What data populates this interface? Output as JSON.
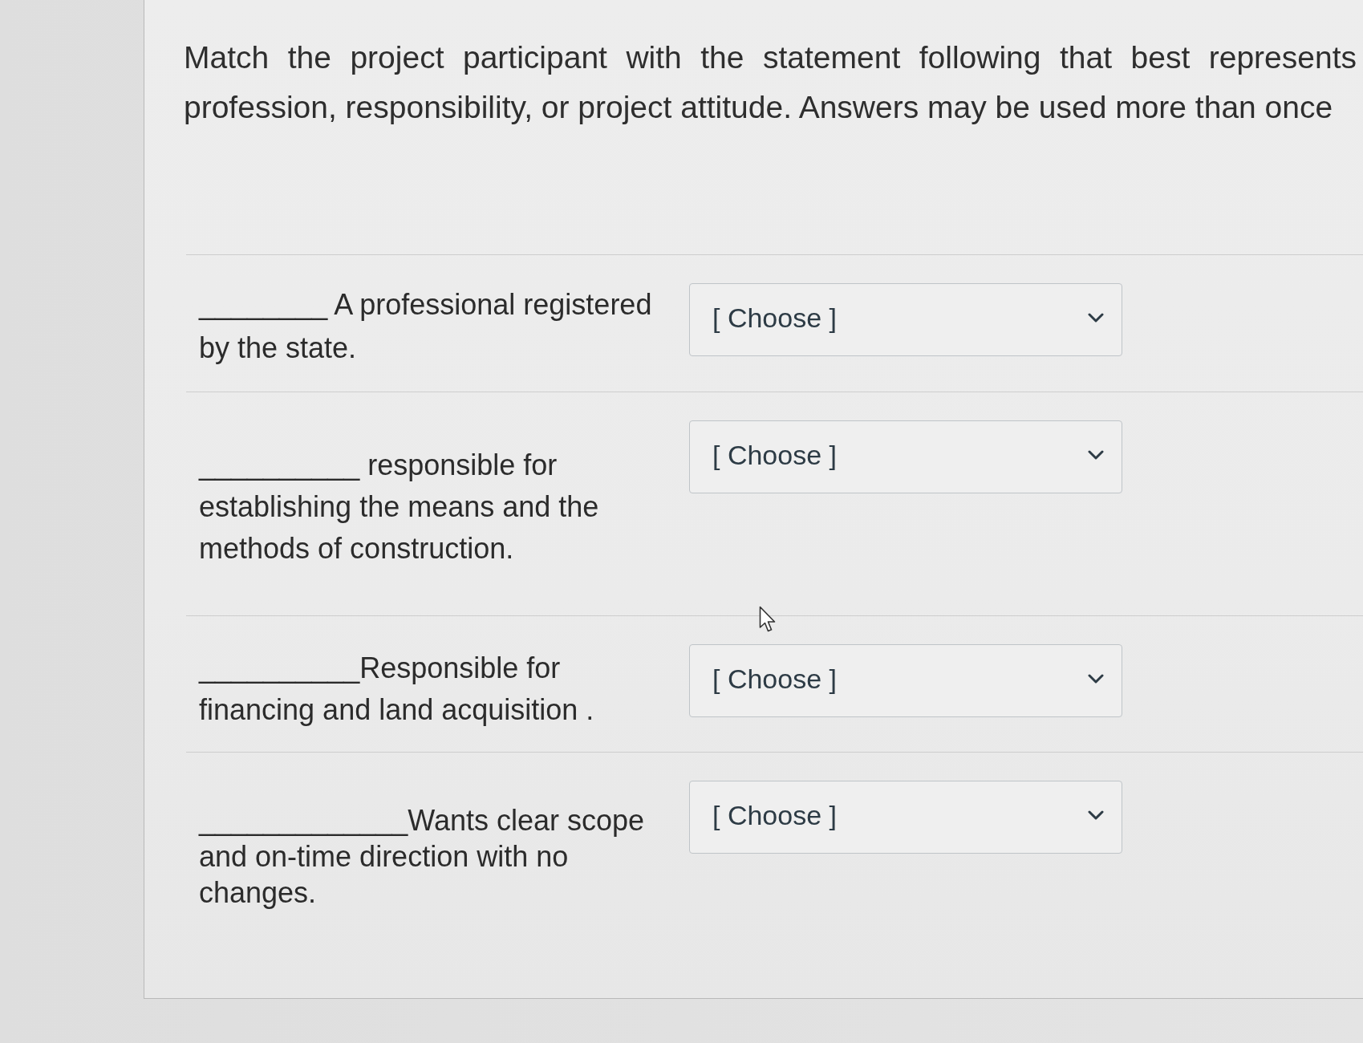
{
  "question": {
    "text": "Match the project participant with the statement following that best represents profession, responsibility, or project attitude. Answers may be used more than once"
  },
  "items": [
    {
      "prompt": "________ A professional registered by the state.",
      "choice": "[ Choose ]"
    },
    {
      "prompt": "__________ responsible for establishing the means and the methods of construction.",
      "choice": "[ Choose ]"
    },
    {
      "prompt": "__________Responsible for financing and land acquisition .",
      "choice": "[ Choose ]"
    },
    {
      "prompt": "_____________Wants clear scope and on-time direction with no changes.",
      "choice": "[ Choose ]"
    }
  ]
}
